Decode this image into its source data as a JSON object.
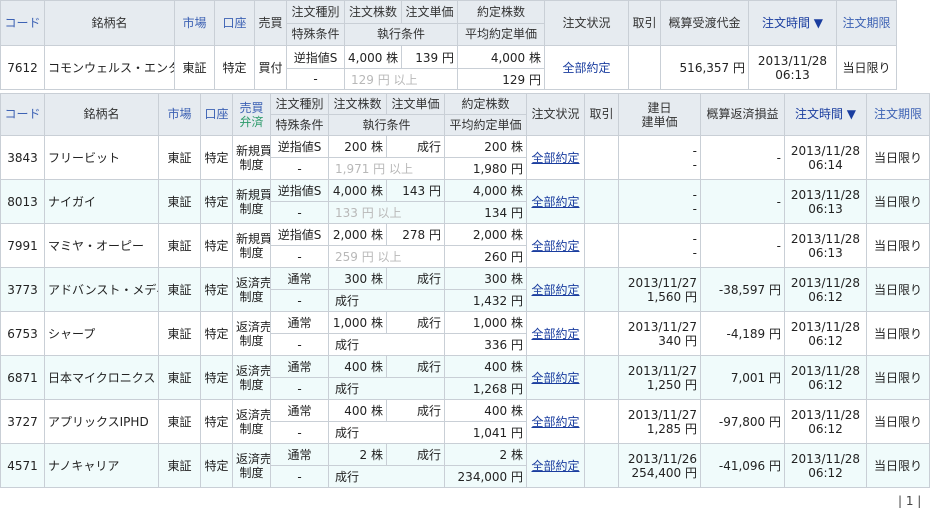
{
  "top_table": {
    "headers": {
      "code": "コード",
      "name": "銘柄名",
      "market": "市場",
      "account": "口座",
      "side": "売買",
      "order_type": "注文種別",
      "special": "特殊条件",
      "qty": "注文株数",
      "price": "注文単価",
      "exec_cond": "執行条件",
      "filled_qty": "約定株数",
      "avg_price": "平均約定単価",
      "status": "注文状況",
      "cancel": "取引",
      "est_amount": "概算受渡代金",
      "order_time": "注文時間 ▼",
      "expiry": "注文期限"
    },
    "rows": [
      {
        "code": "7612",
        "name": "コモンウェルス・エンター",
        "market": "東証",
        "account": "特定",
        "side": "買付",
        "order_type": "逆指値S",
        "qty": "4,000 株",
        "price": "139 円",
        "filled_qty": "4,000 株",
        "special": "-",
        "exec_cond": "129 円 以上",
        "avg_price": "129 円",
        "status": "全部約定",
        "cancel": "",
        "est_amount": "516,357 円",
        "order_time_date": "2013/11/28",
        "order_time_time": "06:13",
        "expiry": "当日限り"
      }
    ]
  },
  "main_table": {
    "headers": {
      "code": "コード",
      "name": "銘柄名",
      "market": "市場",
      "account": "口座",
      "side_a": "売買",
      "side_b": "弁済",
      "order_type": "注文種別",
      "special": "特殊条件",
      "qty": "注文株数",
      "price": "注文単価",
      "exec_cond": "執行条件",
      "filled_qty": "約定株数",
      "avg_price": "平均約定単価",
      "status": "注文状況",
      "cancel": "取引",
      "build_a": "建日",
      "build_b": "建単価",
      "pl": "概算返済損益",
      "order_time": "注文時間 ▼",
      "expiry": "注文期限"
    },
    "rows": [
      {
        "code": "3843",
        "name": "フリービット",
        "market": "東証",
        "account": "特定",
        "side_a": "新規買",
        "side_b": "制度",
        "order_type": "逆指値S",
        "qty": "200 株",
        "price": "成行",
        "filled_qty": "200 株",
        "special": "-",
        "exec_cond": "1,971 円 以上",
        "avg_price": "1,980 円",
        "status": "全部約定",
        "cancel": "",
        "build_a": "-",
        "build_b": "-",
        "pl": "-",
        "time_a": "2013/11/28",
        "time_b": "06:14",
        "expiry": "当日限り"
      },
      {
        "code": "8013",
        "name": "ナイガイ",
        "market": "東証",
        "account": "特定",
        "side_a": "新規買",
        "side_b": "制度",
        "order_type": "逆指値S",
        "qty": "4,000 株",
        "price": "143 円",
        "filled_qty": "4,000 株",
        "special": "-",
        "exec_cond": "133 円 以上",
        "avg_price": "134 円",
        "status": "全部約定",
        "cancel": "",
        "build_a": "-",
        "build_b": "-",
        "pl": "-",
        "time_a": "2013/11/28",
        "time_b": "06:13",
        "expiry": "当日限り"
      },
      {
        "code": "7991",
        "name": "マミヤ・オーピー",
        "market": "東証",
        "account": "特定",
        "side_a": "新規買",
        "side_b": "制度",
        "order_type": "逆指値S",
        "qty": "2,000 株",
        "price": "278 円",
        "filled_qty": "2,000 株",
        "special": "-",
        "exec_cond": "259 円 以上",
        "avg_price": "260 円",
        "status": "全部約定",
        "cancel": "",
        "build_a": "-",
        "build_b": "-",
        "pl": "-",
        "time_a": "2013/11/28",
        "time_b": "06:13",
        "expiry": "当日限り"
      },
      {
        "code": "3773",
        "name": "アドバンスト・メディア",
        "market": "東証",
        "account": "特定",
        "side_a": "返済売",
        "side_b": "制度",
        "order_type": "通常",
        "qty": "300 株",
        "price": "成行",
        "filled_qty": "300 株",
        "special": "-",
        "exec_cond": "成行",
        "avg_price": "1,432 円",
        "status": "全部約定",
        "cancel": "",
        "build_a": "2013/11/27",
        "build_b": "1,560 円",
        "pl": "-38,597 円",
        "time_a": "2013/11/28",
        "time_b": "06:12",
        "expiry": "当日限り"
      },
      {
        "code": "6753",
        "name": "シャープ",
        "market": "東証",
        "account": "特定",
        "side_a": "返済売",
        "side_b": "制度",
        "order_type": "通常",
        "qty": "1,000 株",
        "price": "成行",
        "filled_qty": "1,000 株",
        "special": "-",
        "exec_cond": "成行",
        "avg_price": "336 円",
        "status": "全部約定",
        "cancel": "",
        "build_a": "2013/11/27",
        "build_b": "340 円",
        "pl": "-4,189 円",
        "time_a": "2013/11/28",
        "time_b": "06:12",
        "expiry": "当日限り"
      },
      {
        "code": "6871",
        "name": "日本マイクロニクス",
        "market": "東証",
        "account": "特定",
        "side_a": "返済売",
        "side_b": "制度",
        "order_type": "通常",
        "qty": "400 株",
        "price": "成行",
        "filled_qty": "400 株",
        "special": "-",
        "exec_cond": "成行",
        "avg_price": "1,268 円",
        "status": "全部約定",
        "cancel": "",
        "build_a": "2013/11/27",
        "build_b": "1,250 円",
        "pl": "7,001 円",
        "time_a": "2013/11/28",
        "time_b": "06:12",
        "expiry": "当日限り"
      },
      {
        "code": "3727",
        "name": "アプリックスIPHD",
        "market": "東証",
        "account": "特定",
        "side_a": "返済売",
        "side_b": "制度",
        "order_type": "通常",
        "qty": "400 株",
        "price": "成行",
        "filled_qty": "400 株",
        "special": "-",
        "exec_cond": "成行",
        "avg_price": "1,041 円",
        "status": "全部約定",
        "cancel": "",
        "build_a": "2013/11/27",
        "build_b": "1,285 円",
        "pl": "-97,800 円",
        "time_a": "2013/11/28",
        "time_b": "06:12",
        "expiry": "当日限り"
      },
      {
        "code": "4571",
        "name": "ナノキャリア",
        "market": "東証",
        "account": "特定",
        "side_a": "返済売",
        "side_b": "制度",
        "order_type": "通常",
        "qty": "2 株",
        "price": "成行",
        "filled_qty": "2 株",
        "special": "-",
        "exec_cond": "成行",
        "avg_price": "234,000 円",
        "status": "全部約定",
        "cancel": "",
        "build_a": "2013/11/26",
        "build_b": "254,400 円",
        "pl": "-41,096 円",
        "time_a": "2013/11/28",
        "time_b": "06:12",
        "expiry": "当日限り"
      }
    ]
  },
  "pager": "| 1 |",
  "colors": {
    "header_bg": "#e6ebf0",
    "header_text": "#3d62b4",
    "alt_row": "#f0fbfb",
    "link": "#1a3d9f",
    "grey_text": "#b8b8b8"
  }
}
